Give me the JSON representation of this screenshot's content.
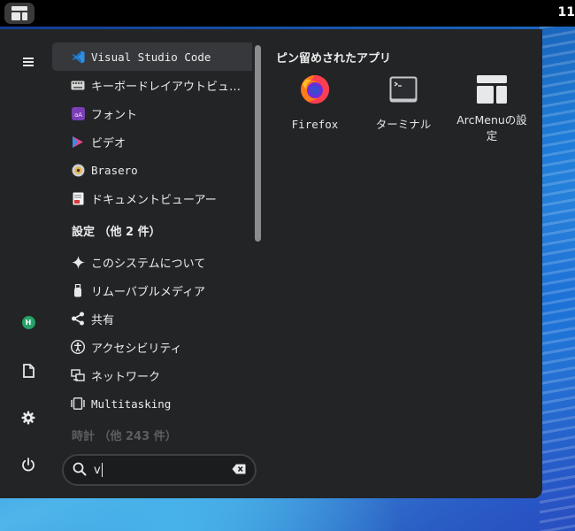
{
  "topbar": {
    "clock": "11"
  },
  "sidebar": {
    "avatar_initial": "H"
  },
  "list": {
    "apps": [
      {
        "label": "Visual Studio Code",
        "icon": "vscode-icon"
      },
      {
        "label": "キーボードレイアウトビュ…",
        "icon": "keyboard-icon"
      },
      {
        "label": "フォント",
        "icon": "fonts-icon"
      },
      {
        "label": "ビデオ",
        "icon": "video-icon"
      },
      {
        "label": "Brasero",
        "icon": "brasero-icon"
      },
      {
        "label": "ドキュメントビューアー",
        "icon": "document-viewer-icon"
      }
    ],
    "settings_header": "設定 （他 2 件）",
    "settings": [
      {
        "label": "このシステムについて",
        "icon": "sparkle-icon"
      },
      {
        "label": "リムーバブルメディア",
        "icon": "usb-icon"
      },
      {
        "label": "共有",
        "icon": "share-icon"
      },
      {
        "label": "アクセシビリティ",
        "icon": "accessibility-icon"
      },
      {
        "label": "ネットワーク",
        "icon": "network-icon"
      },
      {
        "label": "Multitasking",
        "icon": "multitasking-icon"
      }
    ],
    "clock_header": "時計 （他 243 件）"
  },
  "search": {
    "value": "v"
  },
  "pinned": {
    "title": "ピン留めされたアプリ",
    "apps": [
      {
        "label": "Firefox",
        "icon": "firefox-icon"
      },
      {
        "label": "ターミナル",
        "icon": "terminal-icon"
      },
      {
        "label": "ArcMenuの設定",
        "icon": "arcmenu-settings-icon"
      }
    ]
  },
  "colors": {
    "menu_bg": "#222426",
    "selected_bg": "#36383b",
    "avatar": "#26a269"
  }
}
